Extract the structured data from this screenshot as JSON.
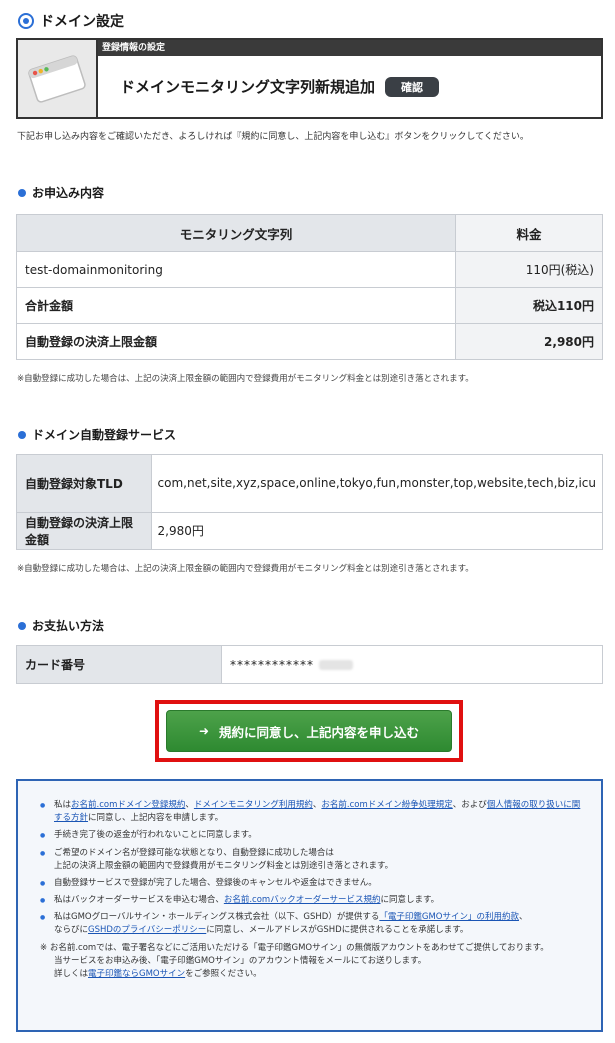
{
  "page": {
    "title": "ドメイン設定"
  },
  "banner": {
    "label": "登録情報の設定",
    "heading": "ドメインモニタリング文字列新規追加",
    "badge": "確認",
    "icon": "window-icon"
  },
  "intro": "下記お申し込み内容をご確認いただき、よろしければ『規約に同意し、上記内容を申し込む』ボタンをクリックしてください。",
  "order": {
    "section_title": "お申込み内容",
    "headers": [
      "モニタリング文字列",
      "料金"
    ],
    "rows": [
      {
        "label": "test-domainmonitoring",
        "value": "110円(税込)"
      },
      {
        "label": "合計金額",
        "value": "税込110円"
      },
      {
        "label": "自動登録の決済上限金額",
        "value": "2,980円"
      }
    ],
    "note": "※自動登録に成功した場合は、上記の決済上限金額の範囲内で登録費用がモニタリング料金とは別途引き落とされます。"
  },
  "auto": {
    "section_title": "ドメイン自動登録サービス",
    "rows": [
      {
        "label": "自動登録対象TLD",
        "value": "com,net,site,xyz,space,online,tokyo,fun,monster,top,website,tech,biz,icu"
      },
      {
        "label": "自動登録の決済上限金額",
        "value": "2,980円"
      }
    ],
    "note": "※自動登録に成功した場合は、上記の決済上限金額の範囲内で登録費用がモニタリング料金とは別途引き落とされます。"
  },
  "payment": {
    "section_title": "お支払い方法",
    "card_label": "カード番号",
    "card_value": "************"
  },
  "cta": {
    "label": "規約に同意し、上記内容を申し込む"
  },
  "terms": {
    "items": [
      {
        "parts": [
          "私は",
          "お名前.comドメイン登録規約",
          "、",
          "ドメインモニタリング利用規約",
          "、",
          "お名前.comドメイン紛争処理規定",
          "、および",
          "個人情報の取り扱いに関する方針",
          "に同意し、上記内容を申請します。"
        ]
      },
      {
        "text": "手続き完了後の返金が行われないことに同意します。"
      },
      {
        "text": "ご希望のドメイン名が登録可能な状態となり、自動登録に成功した場合は",
        "text2": "上記の決済上限金額の範囲内で登録費用がモニタリング料金とは別途引き落とされます。"
      },
      {
        "text": "自動登録サービスで登録が完了した場合、登録後のキャンセルや返金はできません。"
      },
      {
        "parts": [
          "私はバックオーダーサービスを申込む場合、",
          "お名前.comバックオーダーサービス規約",
          "に同意します。"
        ]
      },
      {
        "parts": [
          "私はGMOグローバルサイン・ホールディングス株式会社（以下、GSHD）が提供する",
          "「電子印鑑GMOサイン」の利用約款",
          "、"
        ],
        "parts2": [
          "ならびに",
          "GSHDのプライバシーポリシー",
          "に同意し、メールアドレスがGSHDに提供されることを承諾します。"
        ]
      }
    ],
    "star_note": "※ お名前.comでは、電子署名などにご活用いただける「電子印鑑GMOサイン」の無償版アカウントをあわせてご提供しております。",
    "star_line2": "当サービスをお申込み後、「電子印鑑GMOサイン」のアカウント情報をメールにてお送りします。",
    "star_line3_parts": [
      "詳しくは",
      "電子印鑑ならGMOサイン",
      "をご参照ください。"
    ]
  }
}
